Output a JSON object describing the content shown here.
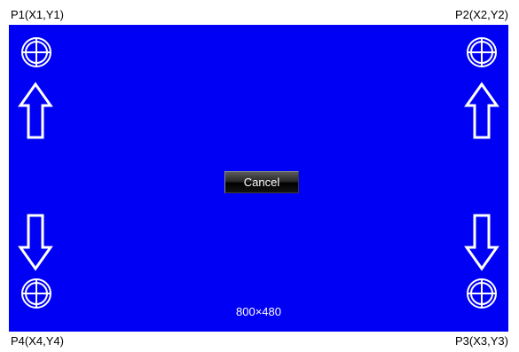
{
  "labels": {
    "p1": "P1(X1,Y1)",
    "p2": "P2(X2,Y2)",
    "p3": "P3(X3,Y3)",
    "p4": "P4(X4,Y4)"
  },
  "screen": {
    "background_color": "#0000f4",
    "resolution": "800×480",
    "cancel_label": "Cancel"
  },
  "icons": {
    "target": "crosshair-circle-icon",
    "up": "arrow-up-icon",
    "down": "arrow-down-icon"
  }
}
